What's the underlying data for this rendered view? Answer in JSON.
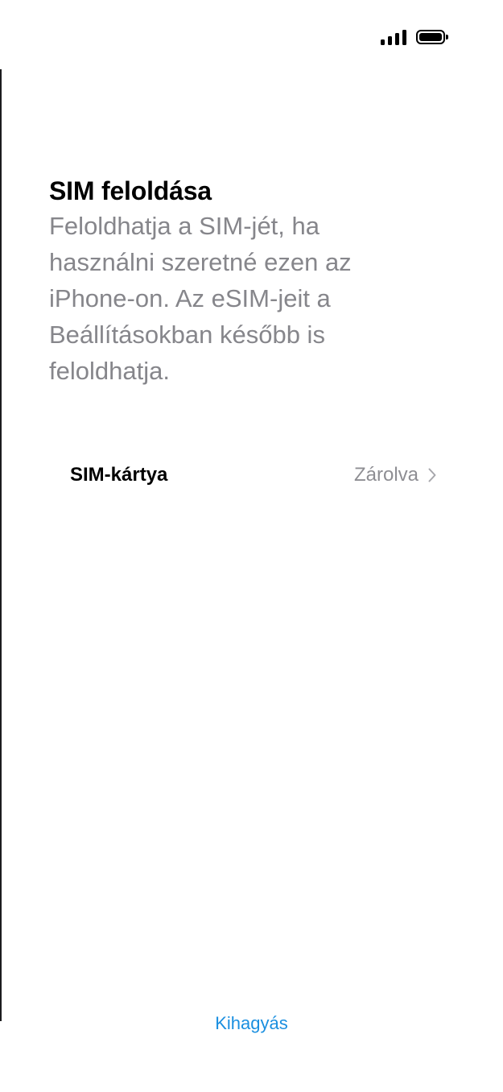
{
  "status_bar": {
    "signal_icon": "cellular-signal-icon",
    "battery_icon": "battery-full-icon"
  },
  "header": {
    "title": "SIM feloldása",
    "description": "Feloldhatja a SIM-jét, ha használni szeretné ezen az iPhone-on. Az eSIM-jeit a Beállításokban később is feloldhatja."
  },
  "sim_list": {
    "items": [
      {
        "label": "SIM-kártya",
        "status": "Zárolva",
        "icon": "chevron-right-icon"
      }
    ]
  },
  "footer": {
    "skip_label": "Kihagyás"
  },
  "colors": {
    "accent": "#1a8fe0",
    "secondary_text": "#86868b",
    "primary_text": "#000000"
  }
}
